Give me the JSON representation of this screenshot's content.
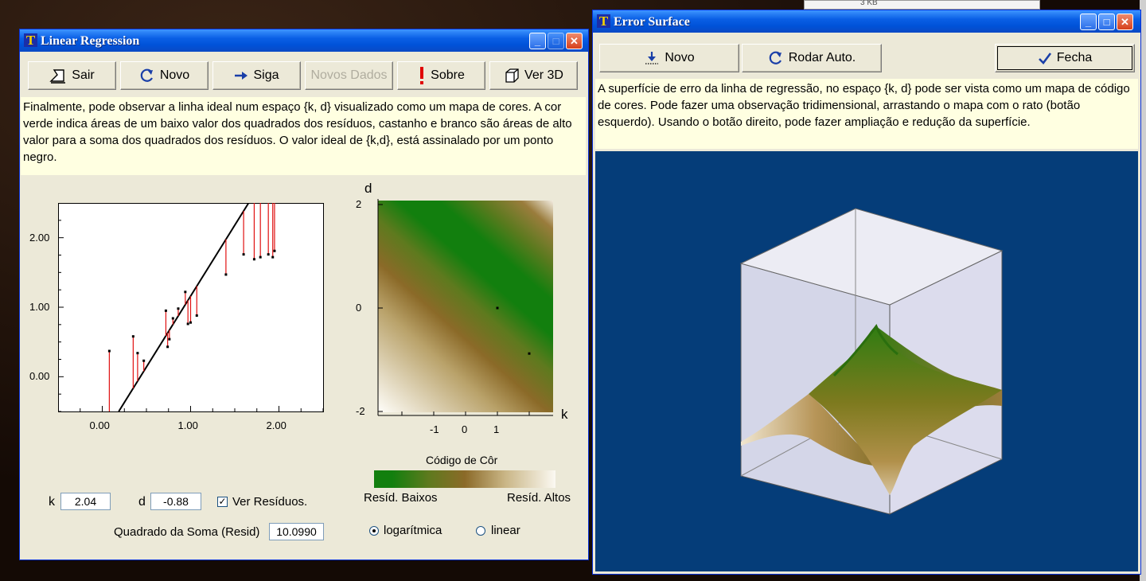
{
  "desktop": {
    "bg_item_text": "3 KB"
  },
  "left_window": {
    "title": "Linear Regression",
    "buttons": {
      "sair": "Sair",
      "novo": "Novo",
      "siga": "Siga",
      "novos_dados": "Novos Dados",
      "sobre": "Sobre",
      "ver3d": "Ver 3D"
    },
    "message": "Finalmente, pode observar a linha ideal num espaço {k, d} visualizado como um mapa de cores. A cor verde indica áreas de um baixo  valor dos quadrados dos resíduos, castanho e branco são áreas de alto valor para a soma dos quadrados dos resíduos. O valor ideal de {k,d},  está assinalado por um ponto negro.",
    "k_label": "k",
    "k_value": "2.04",
    "d_label": "d",
    "d_value": "-0.88",
    "ver_residuos_label": "Ver Resíduos.",
    "ver_residuos_checked": true,
    "soma_label": "Quadrado da Soma (Resid)",
    "soma_value": "10.0990",
    "colormap_y_axis_label": "d",
    "colormap_x_axis_label": "k",
    "colormap_legend_title": "Código de Côr",
    "legend_low": "Resíd. Baixos",
    "legend_high": "Resíd. Altos",
    "scale_options": [
      {
        "label": "logarítmica",
        "selected": true
      },
      {
        "label": "linear",
        "selected": false
      }
    ]
  },
  "right_window": {
    "title": "Error Surface",
    "buttons": {
      "novo": "Novo",
      "rodar": "Rodar Auto.",
      "fecha": "Fecha"
    },
    "message": "A superfície de erro da linha de regressão, no espaço {k, d} pode ser vista como um mapa de código de cores. Pode fazer uma observação  tridimensional, arrastando o mapa com o rato (botão esquerdo). Usando o botão direito, pode fazer ampliação e redução da superfície."
  },
  "colors": {
    "green": "#127f0e",
    "brown": "#8b6a28",
    "white": "#fbf9f2",
    "residual": "#e01010",
    "plot_bg_3d": "#053d79"
  },
  "chart_data": [
    {
      "type": "scatter",
      "title": "",
      "xlabel": "",
      "ylabel": "",
      "xlim": [
        -0.5,
        2.5
      ],
      "ylim": [
        -0.5,
        2.5
      ],
      "x_ticks": [
        "0.00",
        "1.00",
        "2.00"
      ],
      "y_ticks": [
        "0.00",
        "1.00",
        "2.00"
      ],
      "fit_line": {
        "k": 2.04,
        "d": -0.88
      },
      "points": [
        [
          0.08,
          0.37
        ],
        [
          0.35,
          0.58
        ],
        [
          0.4,
          0.34
        ],
        [
          0.47,
          0.23
        ],
        [
          0.72,
          0.95
        ],
        [
          0.74,
          0.43
        ],
        [
          0.76,
          0.54
        ],
        [
          0.8,
          0.84
        ],
        [
          0.86,
          0.98
        ],
        [
          0.94,
          1.22
        ],
        [
          0.97,
          0.76
        ],
        [
          1.0,
          0.78
        ],
        [
          1.07,
          0.88
        ],
        [
          1.4,
          1.47
        ],
        [
          1.6,
          1.76
        ],
        [
          1.72,
          1.69
        ],
        [
          1.79,
          1.72
        ],
        [
          1.88,
          1.76
        ],
        [
          1.93,
          1.72
        ],
        [
          1.95,
          1.81
        ]
      ]
    },
    {
      "type": "heatmap",
      "title": "",
      "xlabel": "k",
      "ylabel": "d",
      "x_ticks": [
        "-1",
        "0",
        "1"
      ],
      "y_ticks": [
        "2",
        "0",
        "-2"
      ],
      "markers": [
        [
          1.0,
          0.0
        ],
        [
          2.0,
          -0.88
        ]
      ]
    }
  ]
}
